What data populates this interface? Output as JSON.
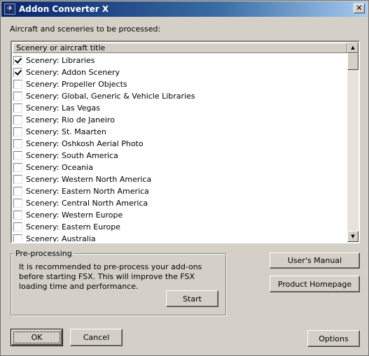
{
  "window": {
    "title": "Addon Converter X",
    "close_glyph": "✕",
    "icon": "airplane-icon"
  },
  "list": {
    "caption": "Aircraft and sceneries to be processed:",
    "column_header": "Scenery or aircraft title",
    "items": [
      {
        "label": "Scenery: Libraries",
        "checked": true
      },
      {
        "label": "Scenery: Addon Scenery",
        "checked": true
      },
      {
        "label": "Scenery: Propeller Objects",
        "checked": false
      },
      {
        "label": "Scenery: Global, Generic & Vehicle Libraries",
        "checked": false
      },
      {
        "label": "Scenery: Las Vegas",
        "checked": false
      },
      {
        "label": "Scenery: Rio de Janeiro",
        "checked": false
      },
      {
        "label": "Scenery: St. Maarten",
        "checked": false
      },
      {
        "label": "Scenery: Oshkosh Aerial Photo",
        "checked": false
      },
      {
        "label": "Scenery: South America",
        "checked": false
      },
      {
        "label": "Scenery: Oceania",
        "checked": false
      },
      {
        "label": "Scenery: Western North America",
        "checked": false
      },
      {
        "label": "Scenery: Eastern North America",
        "checked": false
      },
      {
        "label": "Scenery: Central North America",
        "checked": false
      },
      {
        "label": "Scenery: Western Europe",
        "checked": false
      },
      {
        "label": "Scenery: Eastern Europe",
        "checked": false
      },
      {
        "label": "Scenery: Australia",
        "checked": false
      }
    ]
  },
  "preprocessing": {
    "title": "Pre-processing",
    "text": "It is recommended to pre-process your add-ons before starting FSX. This will improve the FSX loading time and performance.",
    "start_label": "Start"
  },
  "buttons": {
    "users_manual": "User's Manual",
    "product_homepage": "Product Homepage",
    "ok": "OK",
    "cancel": "Cancel",
    "options": "Options"
  }
}
